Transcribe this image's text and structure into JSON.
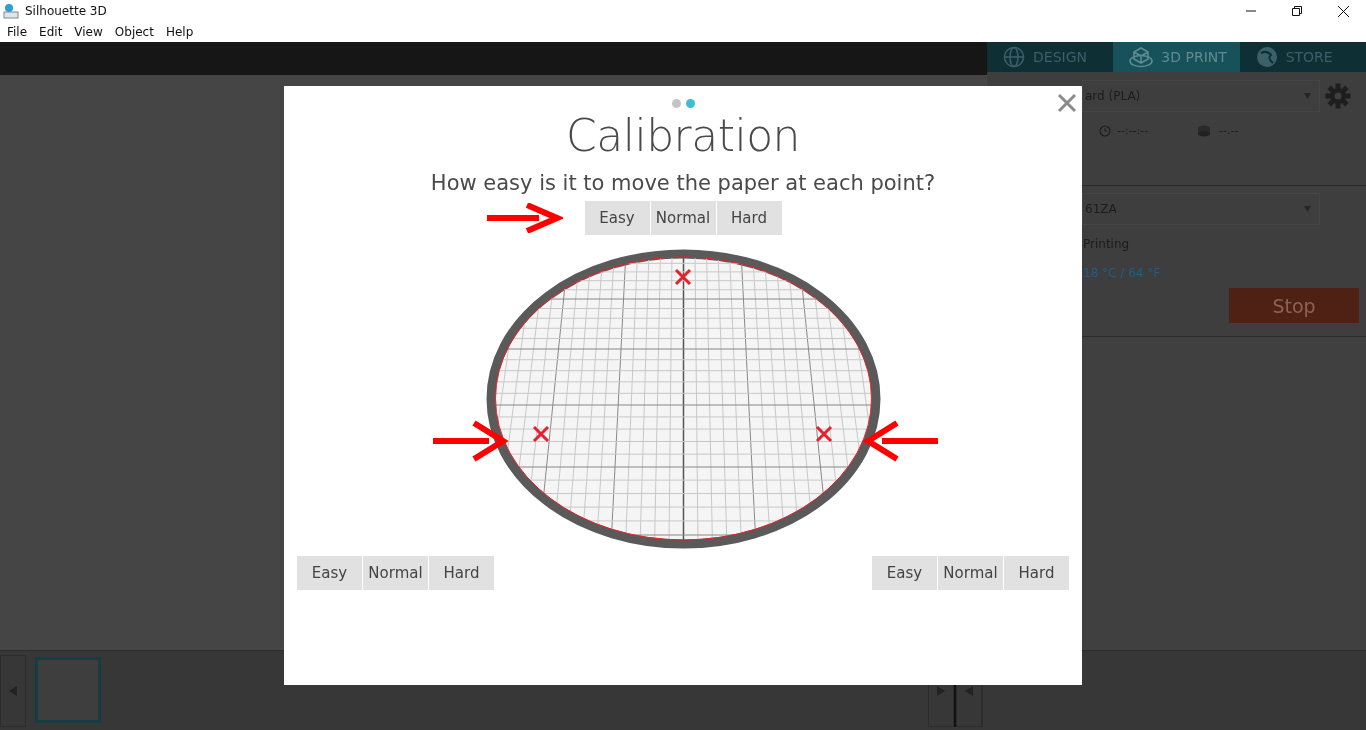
{
  "window": {
    "title": "Silhouette 3D"
  },
  "menu": [
    "File",
    "Edit",
    "View",
    "Object",
    "Help"
  ],
  "tabs": [
    {
      "label": "DESIGN",
      "selected": false
    },
    {
      "label": "3D PRINT",
      "selected": true
    },
    {
      "label": "STORE",
      "selected": false
    }
  ],
  "panel": {
    "material": "ard (PLA)",
    "print_time": "--:--:--",
    "filament": "--.--",
    "printer": "61ZA",
    "status": "Printing",
    "temperature": "18 °C / 64 °F",
    "stop_button": "Stop"
  },
  "dialog": {
    "page_dots": [
      {
        "selected": false
      },
      {
        "selected": true
      }
    ],
    "title": "Calibration",
    "question": "How easy is it to move the paper at each point?",
    "point_choices": [
      {
        "kind": "top",
        "options": [
          {
            "label": "Easy",
            "selected": false
          },
          {
            "label": "Normal",
            "selected": false
          },
          {
            "label": "Hard",
            "selected": false
          }
        ]
      },
      {
        "kind": "left",
        "options": [
          {
            "label": "Easy",
            "selected": false
          },
          {
            "label": "Normal",
            "selected": false
          },
          {
            "label": "Hard",
            "selected": false
          }
        ]
      },
      {
        "kind": "right",
        "options": [
          {
            "label": "Easy",
            "selected": false
          },
          {
            "label": "Normal",
            "selected": false
          },
          {
            "label": "Hard",
            "selected": false
          }
        ]
      }
    ]
  }
}
